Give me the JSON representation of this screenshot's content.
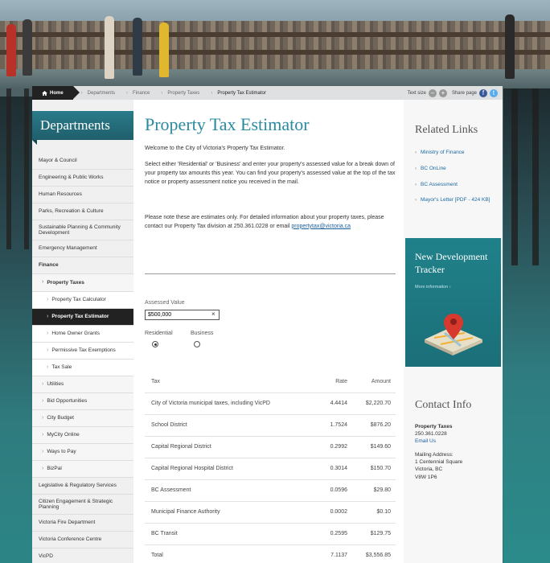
{
  "breadcrumb": {
    "items": [
      "Home",
      "Departments",
      "Finance",
      "Property Taxes",
      "Property Tax Estimator"
    ]
  },
  "tools": {
    "text_size_label": "Text size",
    "minus": "–",
    "plus": "+",
    "share_label": "Share page"
  },
  "sidebar": {
    "header": "Departments",
    "items": [
      "Mayor & Council",
      "Engineering & Public Works",
      "Human Resources",
      "Parks, Recreation & Culture",
      "Sustainable Planning & Community Development",
      "Emergency Management",
      "Finance",
      "Property Taxes",
      "Property Tax Calculator",
      "Property Tax Estimator",
      "Home Owner Grants",
      "Permissive Tax Exemptions",
      "Tax Sale",
      "Utilities",
      "Bid Opportunities",
      "City Budget",
      "MyCity Online",
      "Ways to Pay",
      "BizPal",
      "Legislative & Regulatory Services",
      "Citizen Engagement & Strategic Planning",
      "Victoria Fire Department",
      "Victoria Conference Centre",
      "VicPD"
    ]
  },
  "main": {
    "title": "Property Tax Estimator",
    "intro": "Welcome to the City of Victoria's Property Tax Estimator.",
    "instructions": "Select either 'Residential' or 'Business' and enter your property's assessed value for a break down of your property tax amounts this year. You can find your property's assessed value at the top of the tax notice or property assessment notice you received in the mail.",
    "note": "Please note these are estimates only. For detailed information about your property taxes, please contact our Property Tax division at 250.361.0228 or email",
    "email": "propertytax@victoria.ca",
    "assessed_label": "Assessed Value",
    "assessed_value": "$500,000",
    "clear": "×",
    "radio_residential": "Residential",
    "radio_business": "Business",
    "table": {
      "headers": [
        "Tax",
        "Rate",
        "Amount"
      ],
      "rows": [
        [
          "City of Victoria municipal taxes, including VicPD",
          "4.4414",
          "$2,220.70"
        ],
        [
          "School District",
          "1.7524",
          "$876.20"
        ],
        [
          "Capital Regional District",
          "0.2992",
          "$149.60"
        ],
        [
          "Capital Regional Hospital District",
          "0.3014",
          "$150.70"
        ],
        [
          "BC Assessment",
          "0.0596",
          "$29.80"
        ],
        [
          "Municipal Finance Authority",
          "0.0002",
          "$0.10"
        ],
        [
          "BC Transit",
          "0.2595",
          "$129.75"
        ],
        [
          "Total",
          "7.1137",
          "$3,556.85"
        ]
      ]
    }
  },
  "right": {
    "related_title": "Related Links",
    "links": [
      "Ministry of Finance",
      "BC OnLine",
      "BC Assessment",
      "Mayor's Letter [PDF - 424 KB]"
    ],
    "promo_title": "New Development Tracker",
    "promo_more": "More information ›",
    "contact_title": "Contact Info",
    "contact_name": "Property Taxes",
    "contact_phone": "250.361.0228",
    "contact_email": "Email Us",
    "mailing_label": "Mailing Address:",
    "address1": "1 Centennial Square",
    "address2": "Victoria, BC",
    "postal": "V8W 1P6"
  }
}
